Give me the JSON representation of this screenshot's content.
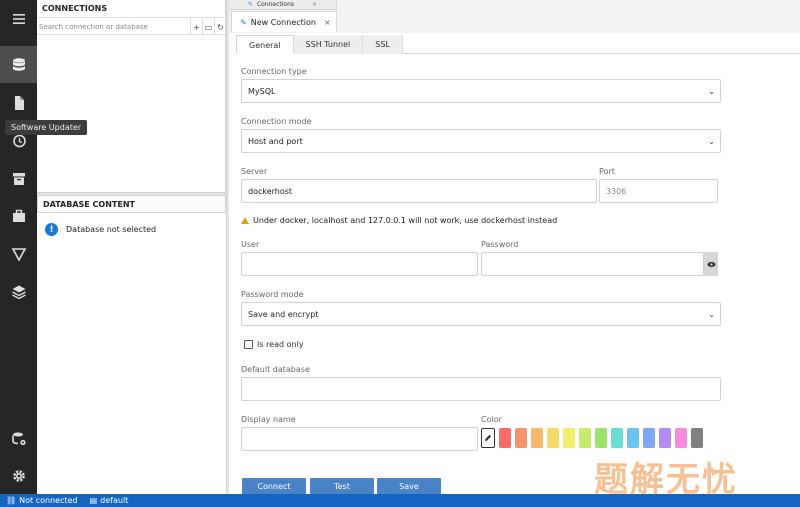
{
  "rail": {
    "tooltip": "Software Updater",
    "icons": [
      "menu-icon",
      "database-icon",
      "file-icon",
      "history-icon",
      "archive-icon",
      "briefcase-icon",
      "filter-icon",
      "layers-icon",
      "database-eye-icon",
      "settings-icon"
    ]
  },
  "connections": {
    "title": "CONNECTIONS",
    "search_placeholder": "Search connection or database",
    "buttons": [
      "+",
      "▭",
      "↻"
    ]
  },
  "database_content": {
    "title": "DATABASE CONTENT",
    "message": "Database not selected"
  },
  "tabs": {
    "top_small": "Connections",
    "top_small_close": "×",
    "active": "New Connection",
    "active_close": "×"
  },
  "sub_tabs": [
    "General",
    "SSH Tunnel",
    "SSL"
  ],
  "form": {
    "connection_type_label": "Connection type",
    "connection_type_value": "MySQL",
    "connection_mode_label": "Connection mode",
    "connection_mode_value": "Host and port",
    "server_label": "Server",
    "server_value": "dockerhost",
    "port_label": "Port",
    "port_value": "3306",
    "warning": "Under docker, localhost and 127.0.0.1 will not work, use dockerhost instead",
    "user_label": "User",
    "user_value": "",
    "password_label": "Password",
    "password_value": "",
    "password_mode_label": "Password mode",
    "password_mode_value": "Save and encrypt",
    "read_only_label": "Is read only",
    "default_database_label": "Default database",
    "default_database_value": "",
    "display_name_label": "Display name",
    "display_name_value": "",
    "color_label": "Color",
    "colors": [
      "#f86b6b",
      "#f6956b",
      "#f8b86b",
      "#f5d96b",
      "#eef06b",
      "#c7ea6b",
      "#9ce36b",
      "#6bdcd1",
      "#6bc4f0",
      "#7ea6f5",
      "#b08cf5",
      "#f58cd9",
      "#808080"
    ]
  },
  "buttons": {
    "connect": "Connect",
    "test": "Test",
    "save": "Save"
  },
  "status": {
    "connection": "Not connected",
    "database": "default"
  },
  "watermark": "题解无忧"
}
